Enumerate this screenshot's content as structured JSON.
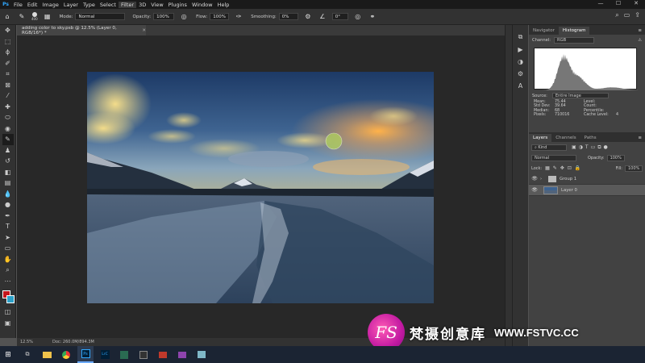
{
  "menubar": {
    "logo": "Ps",
    "items": [
      "File",
      "Edit",
      "Image",
      "Layer",
      "Type",
      "Select",
      "Filter",
      "3D",
      "View",
      "Plugins",
      "Window",
      "Help"
    ],
    "active_item": "Filter"
  },
  "options": {
    "brush_size": "400",
    "mode_label": "Mode:",
    "mode_value": "Normal",
    "opacity_label": "Opacity:",
    "opacity_value": "100%",
    "flow_label": "Flow:",
    "flow_value": "100%",
    "smoothing_label": "Smoothing:",
    "smoothing_value": "0%",
    "angle_value": "0°"
  },
  "document": {
    "tab_title": "adding color to sky.psb @ 12.5% (Layer 0, RGB/16*) *",
    "zoom": "12.5%",
    "doc_size": "Doc: 260.0M/894.3M"
  },
  "panels": {
    "top_tabs": [
      "Navigator",
      "Histogram"
    ],
    "active_top_tab": "Histogram",
    "channel_label": "Channel:",
    "channel_value": "RGB",
    "source_label": "Source:",
    "source_value": "Entire Image",
    "stats": {
      "mean_label": "Mean:",
      "mean": "75.44",
      "level_label": "Level:",
      "level": "",
      "stddev_label": "Std Dev:",
      "stddev": "39.64",
      "count_label": "Count:",
      "count": "",
      "median_label": "Median:",
      "median": "68",
      "percentile_label": "Percentile:",
      "percentile": "",
      "pixels_label": "Pixels:",
      "pixels": "710016",
      "cache_label": "Cache Level:",
      "cache": "4"
    },
    "layer_tabs": [
      "Layers",
      "Channels",
      "Paths"
    ],
    "active_layer_tab": "Layers",
    "kind_label": "Kind",
    "blend_mode": "Normal",
    "opacity_label": "Opacity:",
    "opacity_value": "100%",
    "lock_label": "Lock:",
    "fill_label": "Fill:",
    "fill_value": "100%",
    "layers": [
      {
        "name": "Group 1",
        "type": "group"
      },
      {
        "name": "Layer 0",
        "type": "image",
        "selected": true
      }
    ]
  },
  "watermark": {
    "logo_text": "FS",
    "site_name_cn": "梵摄创意库",
    "url": "WWW.FSTVC.CC"
  },
  "colors": {
    "foreground": "#c4161c",
    "background": "#2ba0c7",
    "accent": "#31a8ff"
  }
}
